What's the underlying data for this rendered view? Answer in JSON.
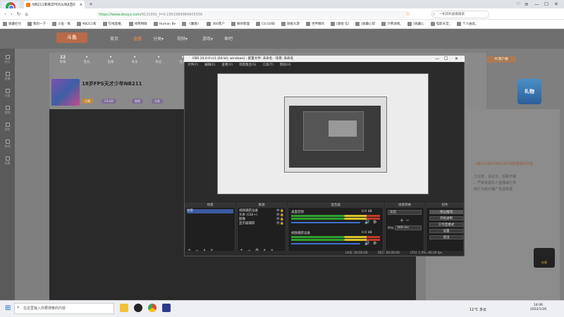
{
  "browser": {
    "logo_label": "立即登录",
    "tab_title": "NB211和和ZHOULINJI直0",
    "new_tab": "+",
    "url_secure": "https://www.douyu.com/",
    "url_rest": "4131991_f=0.1951989984605556",
    "search_placeholder": "一机到机器搬搬家",
    "controls": {
      "pin": "♡",
      "menu": "≡",
      "minimize": "—",
      "maximize": "☐",
      "close": "✕"
    },
    "nav": {
      "back": "‹",
      "forward": "›",
      "reload": "↻",
      "home": "⌂",
      "favorite": "☆"
    },
    "bookmarks": [
      "收藏栏付",
      "我的一下",
      "斗鱼 - 每",
      "NB211和",
      "在线直播_",
      "绿熊物联",
      "Human Be",
      "《魔兽》",
      "360客户",
      "微商管理",
      "CS:GO知",
      "链接头游",
      "世界哪的",
      "[建组 信]",
      "[收藏心得",
      "计费详情_",
      "[收藏心",
      "电影天堂_",
      "个人由此_"
    ]
  },
  "douyu": {
    "logo": "斗鱼",
    "nav": [
      "首页",
      "直播",
      "分类▾",
      "视频▾",
      "游戏▾",
      "鱼吧"
    ],
    "sidebar": [
      "关注",
      "直播",
      "分类",
      "视频",
      "游戏",
      "鱼吧",
      "设置"
    ],
    "stats": [
      {
        "value": "12",
        "label": "等级"
      },
      {
        "value": "",
        "label": "鱼丸"
      },
      {
        "value": "",
        "label": "鱼翅"
      },
      {
        "value": "",
        "label": "关注"
      },
      {
        "value": "",
        "label": "粉丝"
      },
      {
        "value": "",
        "label": "任务"
      }
    ],
    "room_title": "18岁FPS天才少年NB211",
    "tags": [
      "主播",
      "CS:GO",
      "鱼吧",
      "分享"
    ],
    "pc_button": "PC客户端",
    "right_text": "力注意，请合法、招募诈骗\n、严禁未成年人直播或打赏\n的行为和诈骗广告请举报",
    "right_text_hl": "NB211和ZHOULIN 的直播房间分享",
    "gift_label": "礼物",
    "fab_label": "分享"
  },
  "obs": {
    "title": "OBS 24.0.0-rc1 (64-bit, windows) - 配置文件: 未命名 - 场景: 未命名",
    "menu": [
      "文件(F)",
      "编辑(E)",
      "查看(V)",
      "场景集合(S)",
      "工具(T)",
      "帮助(H)"
    ],
    "docks": {
      "scenes": {
        "header": "场景",
        "items": [
          "场景"
        ]
      },
      "sources": {
        "header": "来源",
        "items": [
          "视频捕获设备",
          "文本 (GDI+)",
          "图像",
          "显示器捕获"
        ]
      },
      "mixer": {
        "header": "混音器",
        "channels": [
          {
            "name": "桌面音频",
            "db": "0.0 dB"
          },
          {
            "name": "视频捕获设备",
            "db": "0.0 dB"
          }
        ]
      },
      "transitions": {
        "header": "场景转换",
        "type": "淡出",
        "duration_label": "时长",
        "duration": "300 ms"
      },
      "controls": {
        "header": "控件",
        "buttons": [
          "停止推流",
          "开始录制",
          "工作室模式",
          "设置",
          "退出"
        ]
      }
    },
    "status": {
      "live": "LIVE: 00:00:00",
      "rec": "REC: 00:00:00",
      "cpu": "CPU: 1.9%, 60.00 fps"
    }
  },
  "taskbar": {
    "search_placeholder": "在这里输入你要搜索的内容",
    "weather": "11°C 多云",
    "time": "14:06",
    "date": "2022/1/26"
  }
}
